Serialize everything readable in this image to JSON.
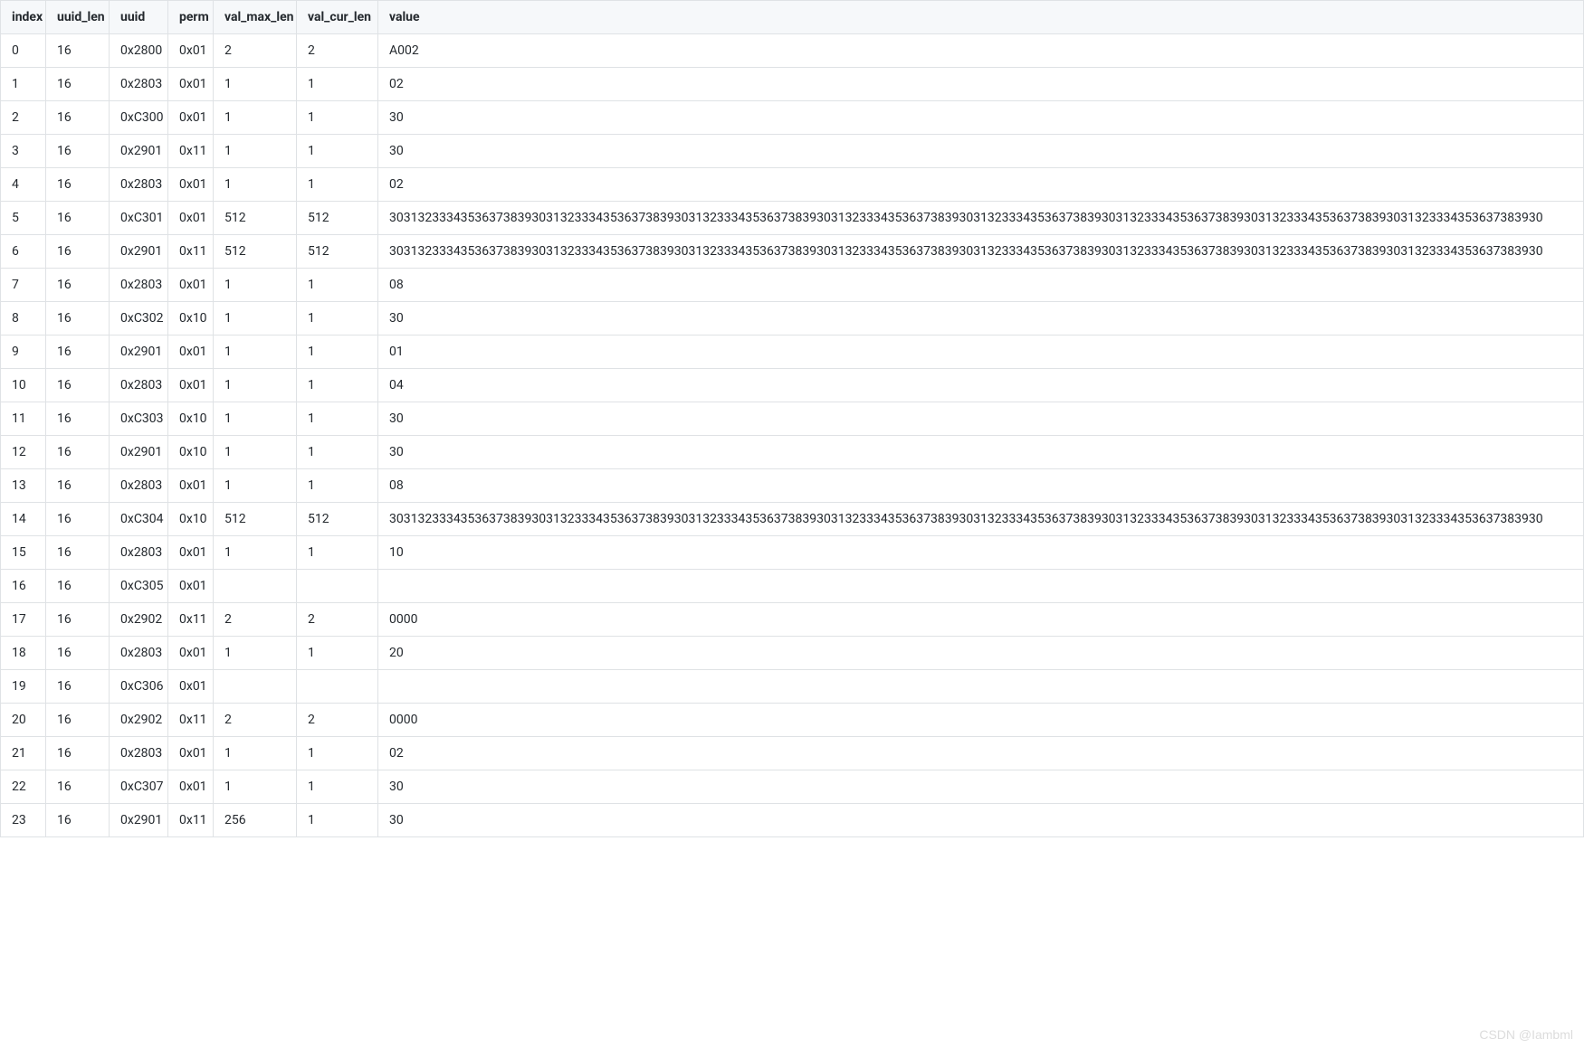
{
  "table": {
    "columns": [
      {
        "key": "index",
        "label": "index"
      },
      {
        "key": "uuid_len",
        "label": "uuid_len"
      },
      {
        "key": "uuid",
        "label": "uuid"
      },
      {
        "key": "perm",
        "label": "perm"
      },
      {
        "key": "val_max_len",
        "label": "val_max_len"
      },
      {
        "key": "val_cur_len",
        "label": "val_cur_len"
      },
      {
        "key": "value",
        "label": "value"
      }
    ],
    "rows": [
      {
        "index": "0",
        "uuid_len": "16",
        "uuid": "0x2800",
        "perm": "0x01",
        "val_max_len": "2",
        "val_cur_len": "2",
        "value": "A002"
      },
      {
        "index": "1",
        "uuid_len": "16",
        "uuid": "0x2803",
        "perm": "0x01",
        "val_max_len": "1",
        "val_cur_len": "1",
        "value": "02"
      },
      {
        "index": "2",
        "uuid_len": "16",
        "uuid": "0xC300",
        "perm": "0x01",
        "val_max_len": "1",
        "val_cur_len": "1",
        "value": "30"
      },
      {
        "index": "3",
        "uuid_len": "16",
        "uuid": "0x2901",
        "perm": "0x11",
        "val_max_len": "1",
        "val_cur_len": "1",
        "value": "30"
      },
      {
        "index": "4",
        "uuid_len": "16",
        "uuid": "0x2803",
        "perm": "0x01",
        "val_max_len": "1",
        "val_cur_len": "1",
        "value": "02"
      },
      {
        "index": "5",
        "uuid_len": "16",
        "uuid": "0xC301",
        "perm": "0x01",
        "val_max_len": "512",
        "val_cur_len": "512",
        "value": "303132333435363738393031323334353637383930313233343536373839303132333435363738393031323334353637383930313233343536373839303132333435363738393031323334353637383930"
      },
      {
        "index": "6",
        "uuid_len": "16",
        "uuid": "0x2901",
        "perm": "0x11",
        "val_max_len": "512",
        "val_cur_len": "512",
        "value": "303132333435363738393031323334353637383930313233343536373839303132333435363738393031323334353637383930313233343536373839303132333435363738393031323334353637383930"
      },
      {
        "index": "7",
        "uuid_len": "16",
        "uuid": "0x2803",
        "perm": "0x01",
        "val_max_len": "1",
        "val_cur_len": "1",
        "value": "08"
      },
      {
        "index": "8",
        "uuid_len": "16",
        "uuid": "0xC302",
        "perm": "0x10",
        "val_max_len": "1",
        "val_cur_len": "1",
        "value": "30"
      },
      {
        "index": "9",
        "uuid_len": "16",
        "uuid": "0x2901",
        "perm": "0x01",
        "val_max_len": "1",
        "val_cur_len": "1",
        "value": "01"
      },
      {
        "index": "10",
        "uuid_len": "16",
        "uuid": "0x2803",
        "perm": "0x01",
        "val_max_len": "1",
        "val_cur_len": "1",
        "value": "04"
      },
      {
        "index": "11",
        "uuid_len": "16",
        "uuid": "0xC303",
        "perm": "0x10",
        "val_max_len": "1",
        "val_cur_len": "1",
        "value": "30"
      },
      {
        "index": "12",
        "uuid_len": "16",
        "uuid": "0x2901",
        "perm": "0x10",
        "val_max_len": "1",
        "val_cur_len": "1",
        "value": "30"
      },
      {
        "index": "13",
        "uuid_len": "16",
        "uuid": "0x2803",
        "perm": "0x01",
        "val_max_len": "1",
        "val_cur_len": "1",
        "value": "08"
      },
      {
        "index": "14",
        "uuid_len": "16",
        "uuid": "0xC304",
        "perm": "0x10",
        "val_max_len": "512",
        "val_cur_len": "512",
        "value": "303132333435363738393031323334353637383930313233343536373839303132333435363738393031323334353637383930313233343536373839303132333435363738393031323334353637383930"
      },
      {
        "index": "15",
        "uuid_len": "16",
        "uuid": "0x2803",
        "perm": "0x01",
        "val_max_len": "1",
        "val_cur_len": "1",
        "value": "10"
      },
      {
        "index": "16",
        "uuid_len": "16",
        "uuid": "0xC305",
        "perm": "0x01",
        "val_max_len": "",
        "val_cur_len": "",
        "value": ""
      },
      {
        "index": "17",
        "uuid_len": "16",
        "uuid": "0x2902",
        "perm": "0x11",
        "val_max_len": "2",
        "val_cur_len": "2",
        "value": "0000"
      },
      {
        "index": "18",
        "uuid_len": "16",
        "uuid": "0x2803",
        "perm": "0x01",
        "val_max_len": "1",
        "val_cur_len": "1",
        "value": "20"
      },
      {
        "index": "19",
        "uuid_len": "16",
        "uuid": "0xC306",
        "perm": "0x01",
        "val_max_len": "",
        "val_cur_len": "",
        "value": ""
      },
      {
        "index": "20",
        "uuid_len": "16",
        "uuid": "0x2902",
        "perm": "0x11",
        "val_max_len": "2",
        "val_cur_len": "2",
        "value": "0000"
      },
      {
        "index": "21",
        "uuid_len": "16",
        "uuid": "0x2803",
        "perm": "0x01",
        "val_max_len": "1",
        "val_cur_len": "1",
        "value": "02"
      },
      {
        "index": "22",
        "uuid_len": "16",
        "uuid": "0xC307",
        "perm": "0x01",
        "val_max_len": "1",
        "val_cur_len": "1",
        "value": "30"
      },
      {
        "index": "23",
        "uuid_len": "16",
        "uuid": "0x2901",
        "perm": "0x11",
        "val_max_len": "256",
        "val_cur_len": "1",
        "value": "30"
      }
    ]
  },
  "watermark": "CSDN @Iambml"
}
